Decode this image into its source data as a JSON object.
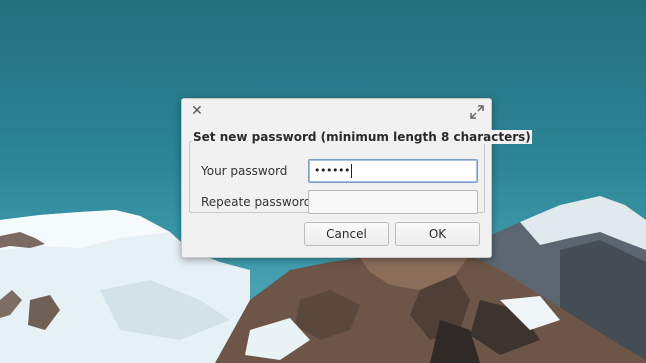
{
  "dialog": {
    "group_title": "Set new password (minimum length 8 characters)",
    "close_glyph": "✕",
    "fields": [
      {
        "label": "Your password",
        "value": "••••••",
        "focused": true
      },
      {
        "label": "Repeate password",
        "value": "",
        "focused": false
      }
    ],
    "buttons": {
      "cancel_label": "Cancel",
      "ok_label": "OK"
    }
  },
  "colors": {
    "sky": "#2c8595",
    "dialog_bg": "#f1f1f1",
    "focus_border": "#7a9cc4"
  },
  "icons": [
    "close-icon",
    "maximize-icon"
  ]
}
